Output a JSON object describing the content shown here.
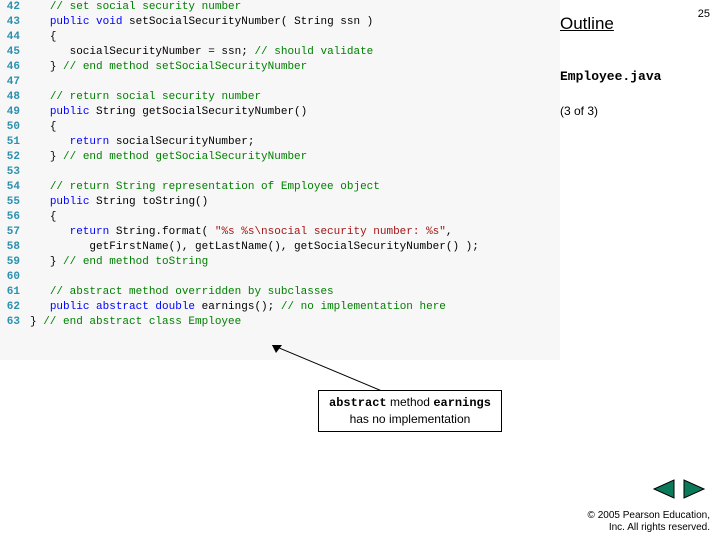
{
  "slide_number": "25",
  "outline_label": "Outline",
  "filename": "Employee.java",
  "file_part": "(3 of 3)",
  "callout": {
    "line1_pre": "abstract",
    "line1_mid": " method ",
    "line1_post": "earnings",
    "line2": "has no implementation"
  },
  "copyright": {
    "line1": "© 2005 Pearson Education,",
    "line2": "Inc. All rights reserved."
  },
  "lines": [
    {
      "num": "42",
      "ind": "   ",
      "seg": [
        {
          "t": "cm",
          "v": "// set social security number"
        }
      ]
    },
    {
      "num": "43",
      "ind": "   ",
      "seg": [
        {
          "t": "kw",
          "v": "public void"
        },
        {
          "t": "n",
          "v": " setSocialSecurityNumber( String ssn )"
        }
      ]
    },
    {
      "num": "44",
      "ind": "   ",
      "seg": [
        {
          "t": "n",
          "v": "{"
        }
      ]
    },
    {
      "num": "45",
      "ind": "      ",
      "seg": [
        {
          "t": "n",
          "v": "socialSecurityNumber = ssn; "
        },
        {
          "t": "cm",
          "v": "// should validate"
        }
      ]
    },
    {
      "num": "46",
      "ind": "   ",
      "seg": [
        {
          "t": "n",
          "v": "} "
        },
        {
          "t": "cm",
          "v": "// end method setSocialSecurityNumber"
        }
      ]
    },
    {
      "num": "47",
      "ind": "",
      "seg": []
    },
    {
      "num": "48",
      "ind": "   ",
      "seg": [
        {
          "t": "cm",
          "v": "// return social security number"
        }
      ]
    },
    {
      "num": "49",
      "ind": "   ",
      "seg": [
        {
          "t": "kw",
          "v": "public"
        },
        {
          "t": "n",
          "v": " String getSocialSecurityNumber()"
        }
      ]
    },
    {
      "num": "50",
      "ind": "   ",
      "seg": [
        {
          "t": "n",
          "v": "{"
        }
      ]
    },
    {
      "num": "51",
      "ind": "      ",
      "seg": [
        {
          "t": "kw",
          "v": "return"
        },
        {
          "t": "n",
          "v": " socialSecurityNumber;"
        }
      ]
    },
    {
      "num": "52",
      "ind": "   ",
      "seg": [
        {
          "t": "n",
          "v": "} "
        },
        {
          "t": "cm",
          "v": "// end method getSocialSecurityNumber"
        }
      ]
    },
    {
      "num": "53",
      "ind": "",
      "seg": []
    },
    {
      "num": "54",
      "ind": "   ",
      "seg": [
        {
          "t": "cm",
          "v": "// return String representation of Employee object"
        }
      ]
    },
    {
      "num": "55",
      "ind": "   ",
      "seg": [
        {
          "t": "kw",
          "v": "public"
        },
        {
          "t": "n",
          "v": " String toString()"
        }
      ]
    },
    {
      "num": "56",
      "ind": "   ",
      "seg": [
        {
          "t": "n",
          "v": "{"
        }
      ]
    },
    {
      "num": "57",
      "ind": "      ",
      "seg": [
        {
          "t": "kw",
          "v": "return"
        },
        {
          "t": "n",
          "v": " String.format( "
        },
        {
          "t": "str",
          "v": "\"%s %s\\nsocial security number: %s\""
        },
        {
          "t": "n",
          "v": ","
        }
      ]
    },
    {
      "num": "58",
      "ind": "         ",
      "seg": [
        {
          "t": "n",
          "v": "getFirstName(), getLastName(), getSocialSecurityNumber() );"
        }
      ]
    },
    {
      "num": "59",
      "ind": "   ",
      "seg": [
        {
          "t": "n",
          "v": "} "
        },
        {
          "t": "cm",
          "v": "// end method toString"
        }
      ]
    },
    {
      "num": "60",
      "ind": "",
      "seg": []
    },
    {
      "num": "61",
      "ind": "   ",
      "seg": [
        {
          "t": "cm",
          "v": "// abstract method overridden by subclasses"
        }
      ]
    },
    {
      "num": "62",
      "ind": "   ",
      "seg": [
        {
          "t": "kw",
          "v": "public abstract double"
        },
        {
          "t": "n",
          "v": " earnings(); "
        },
        {
          "t": "cm",
          "v": "// no implementation here"
        }
      ]
    },
    {
      "num": "63",
      "ind": "",
      "seg": [
        {
          "t": "n",
          "v": "} "
        },
        {
          "t": "cm",
          "v": "// end abstract class Employee"
        }
      ]
    }
  ],
  "nav": {
    "prev": "prev",
    "next": "next"
  }
}
